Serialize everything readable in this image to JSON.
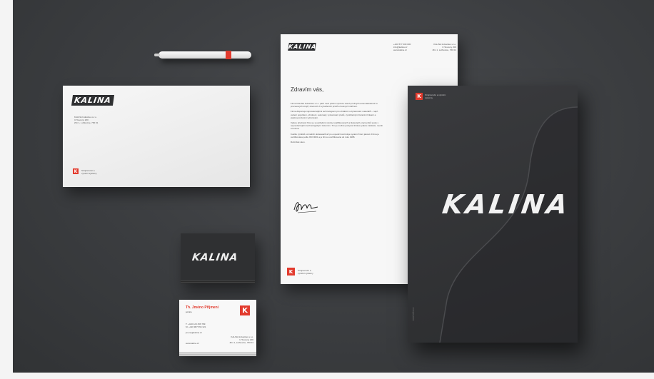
{
  "brand": {
    "logo_text": "KALINA",
    "mark_letter": "K",
    "red": "#e23b2e",
    "dark": "#2f3032"
  },
  "pen": {
    "icon": "pen-icon"
  },
  "envelope": {
    "sender_lines": [
      "KALINA Industries s.r.o.",
      "U Tesovny 200",
      "Zlín 1, Lužkovice, 760 01"
    ],
    "footer_lines": [
      "Strojírenství a",
      "výrobní sýstémy"
    ]
  },
  "letter": {
    "contact_lines": [
      "+420 577 009 000",
      "info@kalina.cz",
      "www.kalina.cz"
    ],
    "address_lines": [
      "KALINA Industries s.r.o.",
      "U Tesovny 200",
      "Zlín 1, Lužkovice, 760 01"
    ],
    "greeting": "Zdravím vás,",
    "paragraphs": [
      "Firma KALINA Industries s.r.o. patří mezi přední výrobce všech pružných automatizačních a procesových strojů, obecních či vytvářecích prvků a hotových zařízení.",
      "Firma disponuje nejmodernějšími technologiemi pro obrábění a zpracování materiálů – např. vedení pojezdem, obrobení, automaty, vytvarování prvků, vyrobitelnými řezacími linkami a elektroerozivními vyřezávání.",
      "Velkou předností firmy je soustředění výroby, kvalifikovaných a školených pracovníků spolu s nejmodernějším technologickým zázemím. Tím je možné pokrývat širokou paletu zakázek, menší a hotová.",
      "Kvalitu výrobků od našich dodavatelů až po expedici kontroluje systém řízení jakosti. Firma je certifikována podle ISO 9001 a je firmou certifikovaná od roku 1998.",
      "Ročníček sken."
    ],
    "footer_lines": [
      "Strojírenství a",
      "výrobní sýstémy"
    ]
  },
  "folder": {
    "tagline_lines": [
      "Strojírenství a výrobní",
      "sýstémy"
    ],
    "title": "KALINA",
    "spine_text": "www.kalina.cz"
  },
  "business_card_front": {
    "logo_text": "KALINA"
  },
  "business_card_back": {
    "name": "Th. Jméno Příjmení",
    "role": "pozice",
    "phones": [
      "T: +420 123 456 789",
      "M: +420 987 654 321"
    ],
    "email": "jmeno@kalina.cz",
    "website": "www.kalina.cz",
    "company_lines": [
      "KALINA Industries s.r.o.",
      "U Tesovny 200",
      "Zlín 1, Lužkovice, 760 01"
    ]
  }
}
